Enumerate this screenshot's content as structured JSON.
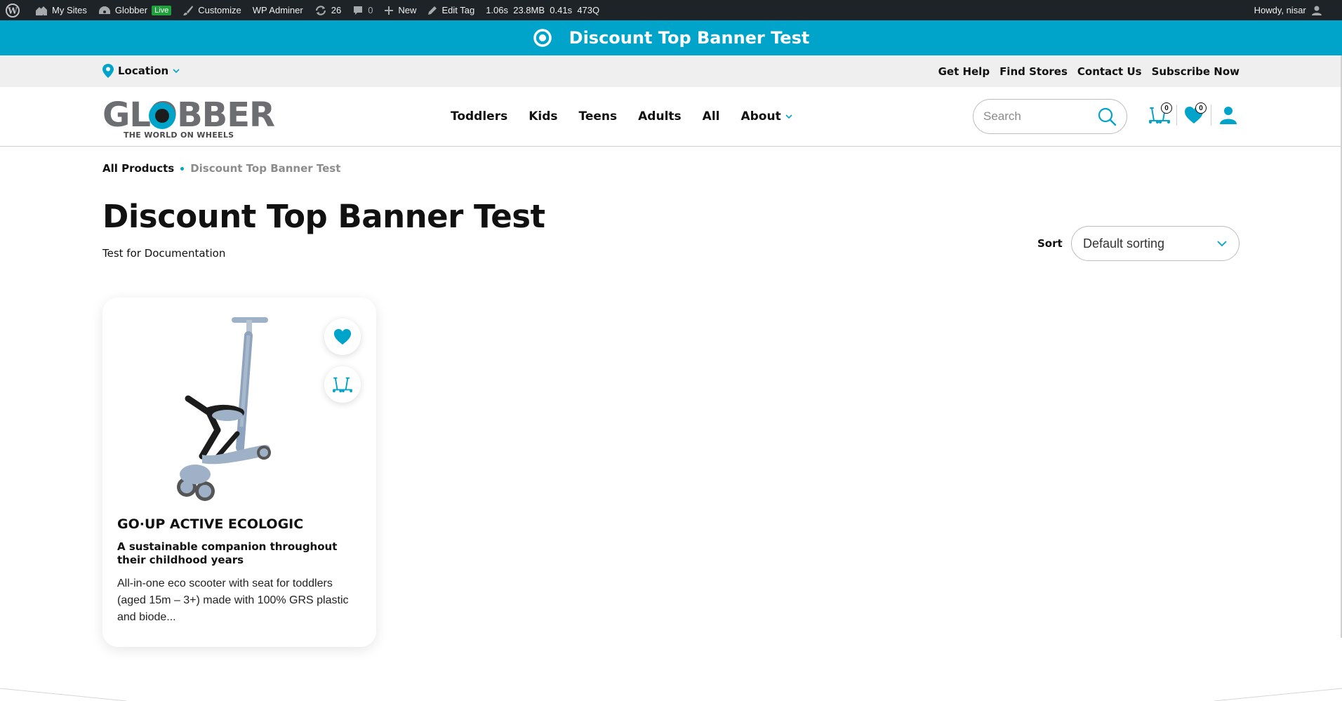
{
  "adminbar": {
    "my_sites": "My Sites",
    "site_name": "Globber",
    "live_badge": "Live",
    "customize": "Customize",
    "wp_adminer": "WP Adminer",
    "updates_count": "26",
    "comments_count": "0",
    "new_label": "New",
    "edit_tag": "Edit Tag",
    "perf_time": "1.06s",
    "perf_mem": "23.8MB",
    "perf_db_time": "0.41s",
    "perf_queries": "473Q",
    "howdy": "Howdy, nisar"
  },
  "banner": {
    "title": "Discount Top Banner Test"
  },
  "utility": {
    "location": "Location",
    "links": [
      "Get Help",
      "Find Stores",
      "Contact Us",
      "Subscribe Now"
    ]
  },
  "header": {
    "logo_word": "GLOBBER",
    "logo_tagline": "THE WORLD ON WHEELS",
    "nav": [
      "Toddlers",
      "Kids",
      "Teens",
      "Adults",
      "All",
      "About"
    ],
    "search_placeholder": "Search",
    "compare_count": "0",
    "wishlist_count": "0"
  },
  "breadcrumb": {
    "root": "All Products",
    "current": "Discount Top Banner Test"
  },
  "page": {
    "title": "Discount Top Banner Test",
    "description": "Test for Documentation",
    "sort_label": "Sort",
    "sort_value": "Default sorting"
  },
  "product": {
    "name": "GO·UP ACTIVE ECOLOGIC",
    "subtitle": "A sustainable companion throughout their childhood years",
    "description": "All-in-one eco scooter with seat for toddlers (aged 15m – 3+) made with 100% GRS plastic and biode..."
  },
  "colors": {
    "accent": "#00a3c9",
    "adminbar": "#1d2327",
    "live": "#1fa03b"
  }
}
